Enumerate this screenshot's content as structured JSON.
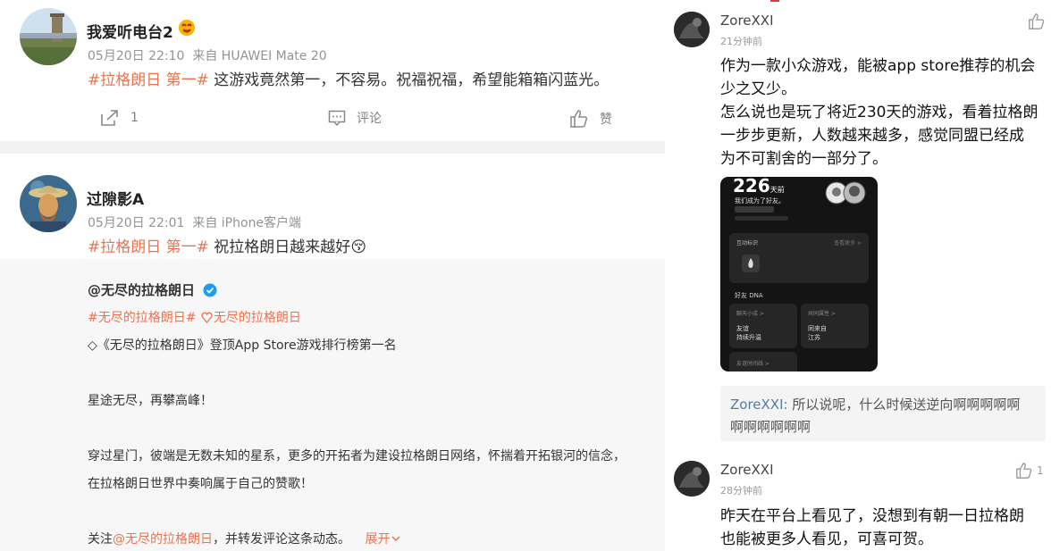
{
  "posts": [
    {
      "username": "我爱听电台2",
      "time": "05月20日 22:10",
      "source": "来自 HUAWEI Mate 20",
      "hashtag": "#拉格朗日 第一#",
      "text": " 这游戏竟然第一，不容易。祝福祝福，希望能箱箱闪蓝光。",
      "repost_count": "1",
      "comment_label": "评论",
      "like_label": "赞"
    },
    {
      "username": "过隙影A",
      "time": "05月20日 22:01",
      "source": "来自 iPhone客户端",
      "hashtag": "#拉格朗日 第一#",
      "text": " 祝拉格朗日越来越好",
      "emoji": "😚"
    }
  ],
  "repost": {
    "author": "@无尽的拉格朗日",
    "tag1": "#无尽的拉格朗日#",
    "tag2": "无尽的拉格朗日",
    "line1": "◇《无尽的拉格朗日》登顶App Store游戏排行榜第一名",
    "line2": "星途无尽，再攀高峰！",
    "line3": "穿过星门，彼端是无数未知的星系，更多的开拓者为建设拉格朗日网络，怀揣着开拓银河的信念，",
    "line4": "在拉格朗日世界中奏响属于自己的赞歌！",
    "follow_prefix": "关注",
    "follow_link": "@无尽的拉格朗日",
    "follow_suffix": "，并转发评论这条动态。",
    "expand_label": "展开"
  },
  "comments": [
    {
      "name": "ZoreXXI",
      "time": "21分钟前",
      "lines": [
        "作为一款小众游戏，能被app store推荐的机会",
        "少之又少。",
        "怎么说也是玩了将近230天的游戏，看着拉格朗",
        "一步步更新，人数越来越多，感觉同盟已经成",
        "为不可割舍的一部分了。"
      ],
      "screenshot": {
        "days": "226",
        "days_unit": "天前",
        "line": "我们成为了好友。",
        "card1_title": "互动标识",
        "card1_link": "查看更多 >",
        "section": "好友 DNA",
        "box1_label": "聊天小成 >",
        "box1_v1": "友谊",
        "box1_v2": "持续升温",
        "box2_label": "共同属性 >",
        "box2_v1": "同来自",
        "box2_v2": "江苏",
        "box3_label": "友谊时间线 >"
      },
      "reply_name": "ZoreXXI:",
      "reply_text1": " 所以说呢，什么时候送逆向啊啊啊啊啊",
      "reply_text2": "啊啊啊啊啊啊"
    },
    {
      "name": "ZoreXXI",
      "time": "28分钟前",
      "like_count": "1",
      "lines": [
        "昨天在平台上看见了，没想到有朝一日拉格朗",
        "也能被更多人看见，可喜可贺。"
      ]
    }
  ],
  "colors": {
    "tag": "#eb7350",
    "verified": "#1f9cf2",
    "reply_name": "#507daf"
  }
}
